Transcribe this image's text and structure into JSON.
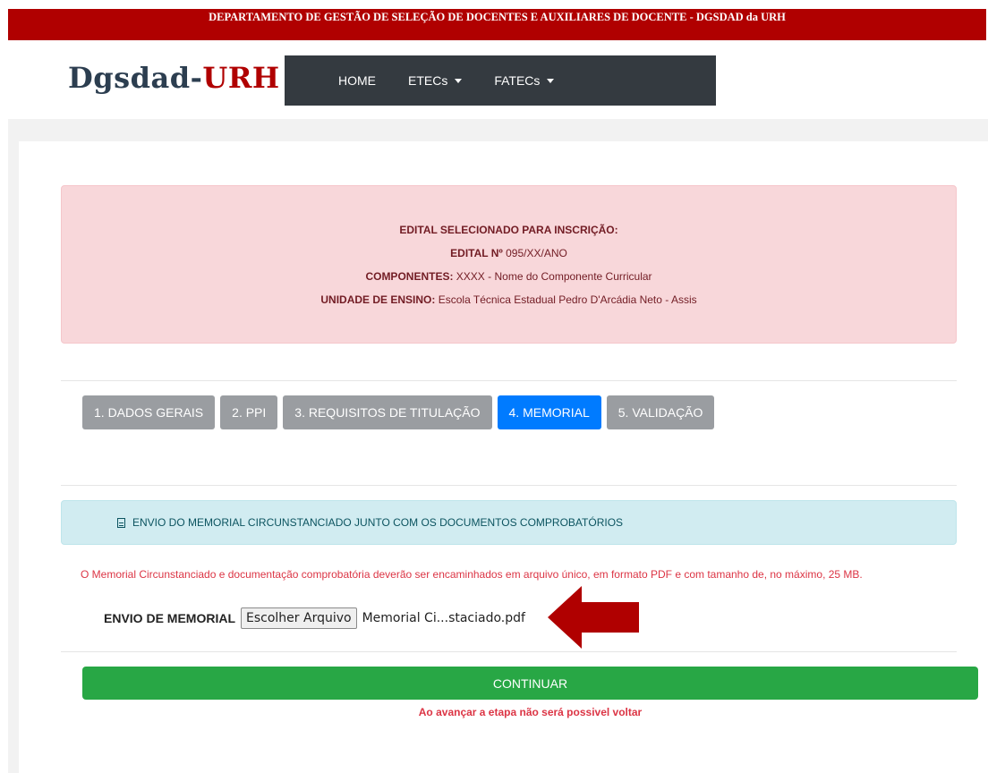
{
  "banner": {
    "text": "DEPARTAMENTO DE GESTÃO DE SELEÇÃO DE DOCENTES E AUXILIARES DE DOCENTE - DGSDAD da URH"
  },
  "logo": {
    "main": "Dgsdad-",
    "accent": "URH"
  },
  "nav": {
    "home": "HOME",
    "etecs": "ETECs",
    "fatecs": "FATECs"
  },
  "edital": {
    "heading": "EDITAL SELECIONADO PARA INSCRIÇÃO:",
    "number_label": "EDITAL Nº",
    "number_value": "095/XX/ANO",
    "components_label": "COMPONENTES:",
    "components_value": "XXXX - Nome do Componente Curricular",
    "unit_label": "UNIDADE DE ENSINO:",
    "unit_value": "Escola Técnica Estadual Pedro D'Arcádia Neto - Assis"
  },
  "steps": [
    {
      "label": "1. DADOS GERAIS",
      "active": false
    },
    {
      "label": "2. PPI",
      "active": false
    },
    {
      "label": "3. REQUISITOS DE TITULAÇÃO",
      "active": false
    },
    {
      "label": "4. MEMORIAL",
      "active": true
    },
    {
      "label": "5. VALIDAÇÃO",
      "active": false
    }
  ],
  "memorial": {
    "header": "ENVIO DO MEMORIAL CIRCUNSTANCIADO JUNTO COM OS DOCUMENTOS COMPROBATÓRIOS",
    "warning": "O Memorial Circunstanciado e documentação comprobatória deverão ser encaminhados em arquivo único, em formato PDF e com tamanho de, no máximo, 25 MB.",
    "upload_label": "ENVIO DE MEMORIAL",
    "choose_button": "Escolher Arquivo",
    "file_name": "Memorial Ci...staciado.pdf"
  },
  "actions": {
    "continue": "CONTINUAR",
    "note": "Ao avançar a etapa não será possivel voltar"
  },
  "colors": {
    "banner": "#b00000",
    "navbar": "#343a40",
    "active_step": "#007bff",
    "inactive_step": "#9a9da1",
    "continue": "#28a745",
    "arrow": "#b00000"
  }
}
